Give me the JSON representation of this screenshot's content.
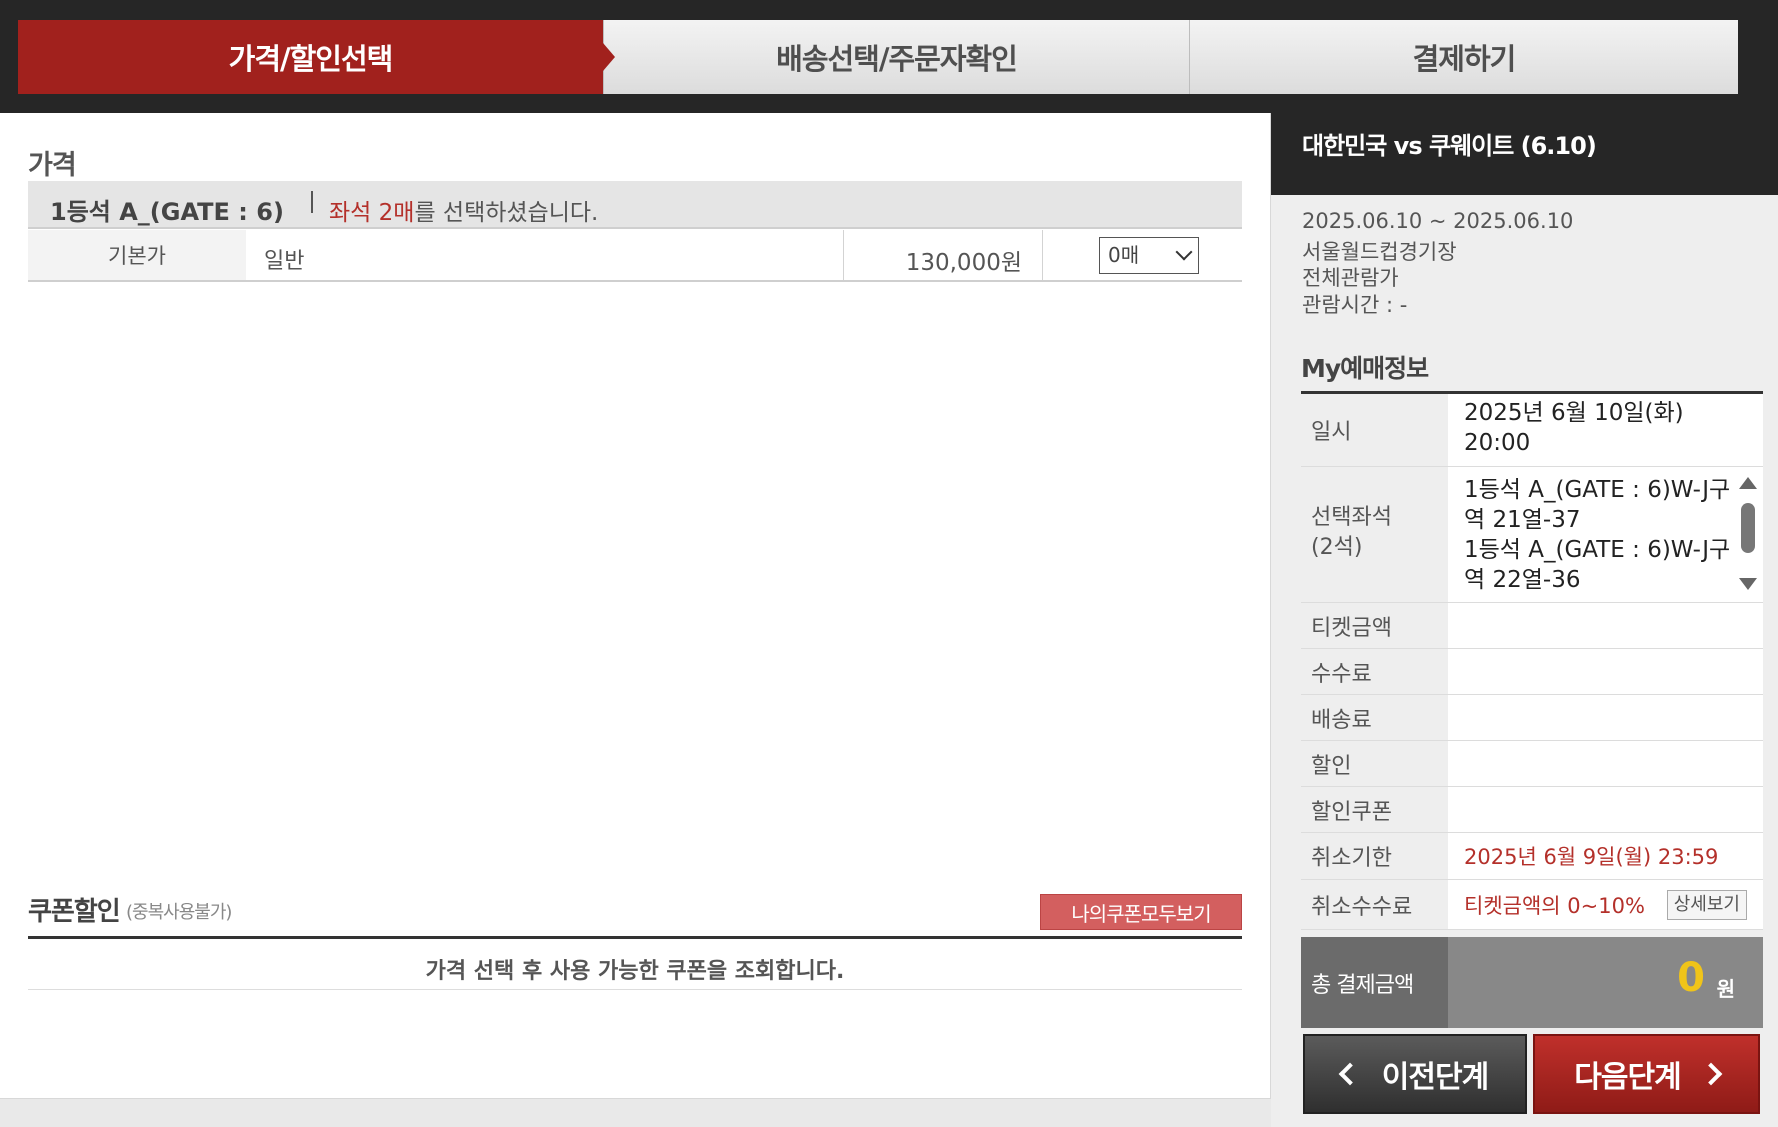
{
  "steps": [
    {
      "label": "가격/할인선택",
      "active": true
    },
    {
      "label": "배송선택/주문자확인",
      "active": false
    },
    {
      "label": "결제하기",
      "active": false
    }
  ],
  "price_section": {
    "title": "가격",
    "grade_name": "1등석 A_(GATE : 6)",
    "msg_prefix": "좌석 2매",
    "msg_suffix": "를 선택하셨습니다.",
    "row": {
      "label": "기본가",
      "type": "일반",
      "amount": "130,000원",
      "qty_selected": "0매"
    }
  },
  "coupon": {
    "title": "쿠폰할인",
    "subtitle": "(중복사용불가)",
    "button": "나의쿠폰모두보기",
    "message": "가격 선택 후 사용 가능한 쿠폰을 조회합니다."
  },
  "event": {
    "title": "대한민국 vs 쿠웨이트 (6.10)",
    "period": "2025.06.10 ~ 2025.06.10",
    "venue": "서울월드컵경기장",
    "rating": "전체관람가",
    "duration": "관람시간 : -"
  },
  "my_booking": {
    "title": "My예매정보",
    "date_label": "일시",
    "date_line1": "2025년 6월 10일(화)",
    "date_line2": "20:00",
    "seat_label_1": "선택좌석",
    "seat_label_2": "(2석)",
    "seats": [
      "1등석 A_(GATE : 6)W-J구역 21열-37",
      "1등석 A_(GATE : 6)W-J구역 22열-36"
    ],
    "ticket_amount_label": "티켓금액",
    "ticket_amount": "",
    "fee_label": "수수료",
    "fee": "",
    "delivery_label": "배송료",
    "delivery": "",
    "discount_label": "할인",
    "discount": "",
    "coupon_label": "할인쿠폰",
    "coupon": "",
    "cancel_deadline_label": "취소기한",
    "cancel_deadline": "2025년 6월 9일(월) 23:59",
    "cancel_fee_label": "취소수수료",
    "cancel_fee": "티켓금액의 0~10%",
    "detail_button": "상세보기",
    "total_label": "총 결제금액",
    "total_value": "0",
    "total_unit": "원"
  },
  "nav": {
    "prev": "이전단계",
    "next": "다음단계"
  },
  "colors": {
    "accent_red": "#a1211d",
    "total_yellow": "#f0c419",
    "dark": "#262626"
  }
}
